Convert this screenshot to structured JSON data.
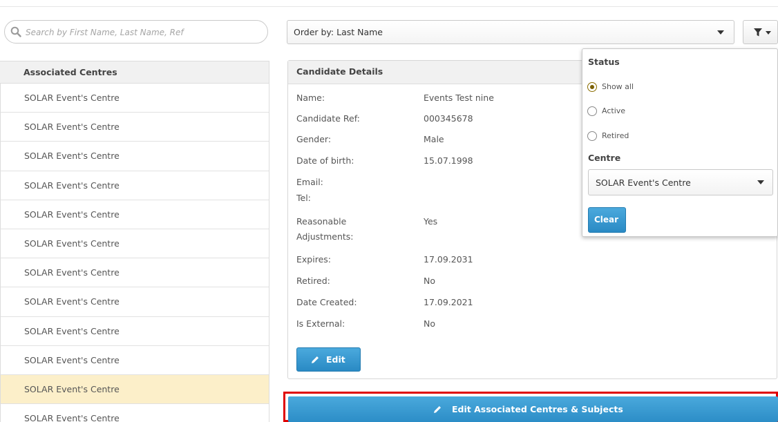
{
  "search": {
    "placeholder": "Search by First Name, Last Name, Ref",
    "icon": "search-icon"
  },
  "orderby": {
    "label": "Order by: Last Name"
  },
  "filter": {
    "icon": "filter-icon"
  },
  "centres": {
    "header": "Associated Centres",
    "rows": [
      "SOLAR Event's Centre",
      "SOLAR Event's Centre",
      "SOLAR Event's Centre",
      "SOLAR Event's Centre",
      "SOLAR Event's Centre",
      "SOLAR Event's Centre",
      "SOLAR Event's Centre",
      "SOLAR Event's Centre",
      "SOLAR Event's Centre",
      "SOLAR Event's Centre",
      "SOLAR Event's Centre",
      "SOLAR Event's Centre"
    ],
    "selected_index": 10
  },
  "details": {
    "header": "Candidate Details",
    "fields": [
      {
        "label": "Name:",
        "value": "Events Test nine"
      },
      {
        "label": "Candidate Ref:",
        "value": "000345678"
      },
      {
        "label": "Gender:",
        "value": "Male"
      },
      {
        "label": "Date of birth:",
        "value": "15.07.1998"
      },
      {
        "label": "Email:",
        "value": ""
      },
      {
        "label": "Tel:",
        "value": ""
      },
      {
        "label": "Reasonable Adjustments:",
        "value": "Yes"
      },
      {
        "label": "Expires:",
        "value": "17.09.2031"
      },
      {
        "label": "Retired:",
        "value": "No"
      },
      {
        "label": "Date Created:",
        "value": "17.09.2021"
      },
      {
        "label": "Is External:",
        "value": "No"
      }
    ],
    "edit_label": "Edit"
  },
  "big_button": {
    "label": "Edit Associated Centres & Subjects"
  },
  "popup": {
    "status_title": "Status",
    "status_options": [
      {
        "label": "Show all",
        "checked": true
      },
      {
        "label": "Active",
        "checked": false
      },
      {
        "label": "Retired",
        "checked": false
      }
    ],
    "centre_title": "Centre",
    "centre_selected": "SOLAR Event's Centre",
    "clear_label": "Clear"
  },
  "colors": {
    "accent": "#2a8ac4",
    "highlight": "#fcefc9",
    "outline": "#e00000"
  }
}
